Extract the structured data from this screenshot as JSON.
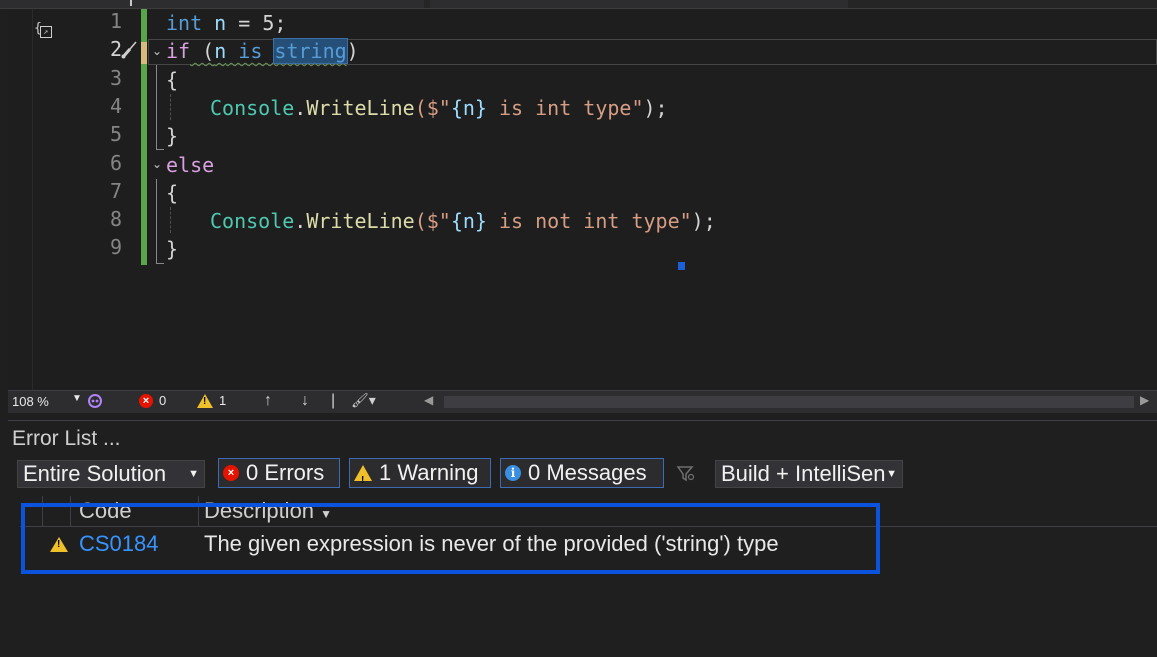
{
  "editor": {
    "line_numbers": [
      "1",
      "2",
      "3",
      "4",
      "5",
      "6",
      "7",
      "8",
      "9"
    ],
    "code": {
      "l1_kw": "int",
      "l1_var": "n",
      "l1_rest": " = 5;",
      "l2_if": "if",
      "l2_open": " (",
      "l2_var": "n",
      "l2_is": " is ",
      "l2_type": "string",
      "l2_close": ")",
      "l3": "{",
      "l4_cls": "Console",
      "l4_dot": ".",
      "l4_meth": "WriteLine",
      "l4_open": "($\"",
      "l4_interp": "{n}",
      "l4_str": " is int type\"",
      "l4_close": ");",
      "l5": "}",
      "l6_else": "else",
      "l7": "{",
      "l8_cls": "Console",
      "l8_dot": ".",
      "l8_meth": "WriteLine",
      "l8_open": "($\"",
      "l8_interp": "{n}",
      "l8_str": " is not int type\"",
      "l8_close": ");",
      "l9": "}"
    }
  },
  "statusbar": {
    "zoom": "108 %",
    "error_count": "0",
    "warning_count": "1"
  },
  "error_list": {
    "title": "Error List ...",
    "scope": "Entire Solution",
    "errors_label": "0 Errors",
    "warnings_label": "1 Warning",
    "messages_label": "0 Messages",
    "build_filter": "Build + IntelliSen",
    "columns": {
      "code": "Code",
      "description": "Description"
    },
    "rows": [
      {
        "code": "CS0184",
        "description": "The given expression is never of the provided ('string') type"
      }
    ]
  },
  "colors": {
    "keyword": "#569cd6",
    "control_keyword": "#d8a0df",
    "class": "#4ec9b0",
    "method": "#dcdcaa",
    "string": "#d69d85",
    "link": "#3794ff",
    "highlight_box": "#0b52dc"
  },
  "icons": [
    "scope-icon",
    "screwdriver-icon",
    "fold-chevron-icon",
    "error-icon",
    "warning-icon",
    "info-icon",
    "up-arrow-icon",
    "down-arrow-icon",
    "brush-icon",
    "filter-icon",
    "copilot-icon"
  ]
}
